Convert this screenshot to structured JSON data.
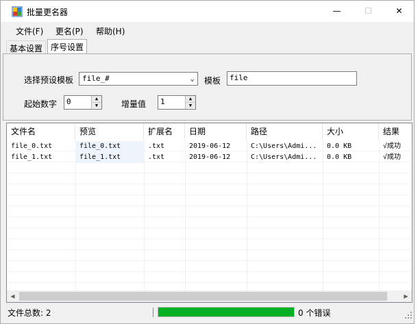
{
  "window": {
    "title": "批量更名器"
  },
  "titlebar": {
    "minimize": "—",
    "maximize": "☐",
    "close": "✕"
  },
  "menu": [
    "文件(F)",
    "更名(P)",
    "帮助(H)"
  ],
  "tabs": [
    {
      "label": "基本设置",
      "active": false
    },
    {
      "label": "序号设置",
      "active": true
    }
  ],
  "settings": {
    "preset_label": "选择预设模板",
    "preset_value": "file_#",
    "template_label": "模板",
    "template_value": "file",
    "start_label": "起始数字",
    "start_value": "0",
    "increment_label": "增量值",
    "increment_value": "1"
  },
  "table": {
    "columns": [
      "文件名",
      "预览",
      "扩展名",
      "日期",
      "路径",
      "大小",
      "结果"
    ],
    "rows": [
      [
        "file_0.txt",
        "file_0.txt",
        ".txt",
        "2019-06-12",
        "C:\\Users\\Admi...",
        "0.0 KB",
        "√成功"
      ],
      [
        "file_1.txt",
        "file_1.txt",
        ".txt",
        "2019-06-12",
        "C:\\Users\\Admi...",
        "0.0 KB",
        "√成功"
      ]
    ]
  },
  "status": {
    "total_label": "文件总数: 2",
    "progress_fraction": 1.0,
    "errors_label": "0 个错误"
  },
  "colors": {
    "progress": "#06b025",
    "preview_bg": "#eef4fc"
  }
}
